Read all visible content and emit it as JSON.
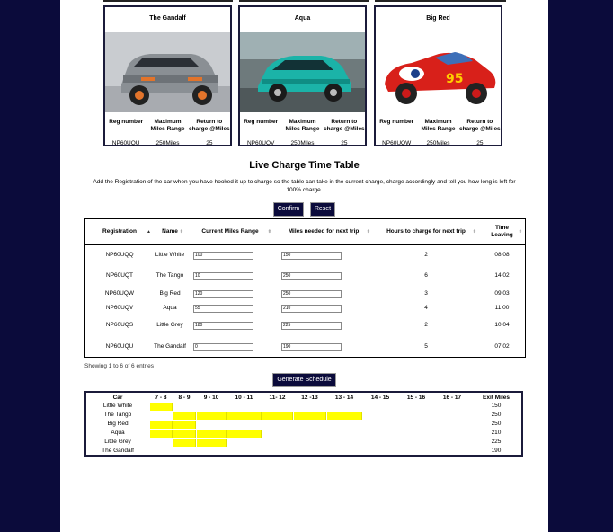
{
  "cars": [
    {
      "name": "The Gandalf",
      "headers": [
        "Reg number",
        "Maximum Miles Range",
        "Return to charge @Miles"
      ],
      "reg": "NP60UQU",
      "range": "250Miles",
      "return": "25",
      "img": "grey-suv"
    },
    {
      "name": "Aqua",
      "headers": [
        "Reg number",
        "Maximum Miles Range",
        "Return to charge @Miles"
      ],
      "reg": "NP60UQV",
      "range": "250Miles",
      "return": "25",
      "img": "teal-hatchback"
    },
    {
      "name": "Big Red",
      "headers": [
        "Reg number",
        "Maximum Miles Range",
        "Return to charge @Miles"
      ],
      "reg": "NP60UQW",
      "range": "250Miles",
      "return": "25",
      "img": "red-toy-car"
    }
  ],
  "timetable": {
    "title": "Live Charge Time Table",
    "description": "Add the Registration of the car when you have hooked it up to charge so the table can take in the current charge, charge accordingly and tell you how long is left for 100% charge.",
    "confirm_label": "Confirm",
    "reset_label": "Reset",
    "columns": [
      "Registration",
      "Name",
      "Current Miles Range",
      "Miles needed for next trip",
      "Hours to charge for next trip",
      "Time Leaving"
    ],
    "rows": [
      {
        "reg": "NP60UQQ",
        "name": "Little White",
        "current": "100",
        "needed": "150",
        "hours": "2",
        "leaving": "08:08"
      },
      {
        "reg": "NP60UQT",
        "name": "The Tango",
        "current": "10",
        "needed": "250",
        "hours": "6",
        "leaving": "14:02"
      },
      {
        "reg": "NP60UQW",
        "name": "Big Red",
        "current": "120",
        "needed": "250",
        "hours": "3",
        "leaving": "09:03"
      },
      {
        "reg": "NP60UQV",
        "name": "Aqua",
        "current": "55",
        "needed": "210",
        "hours": "4",
        "leaving": "11:00"
      },
      {
        "reg": "NP60UQS",
        "name": "Little Grey",
        "current": "180",
        "needed": "225",
        "hours": "2",
        "leaving": "10:04"
      },
      {
        "reg": "NP60UQU",
        "name": "The Gandalf",
        "current": "0",
        "needed": "190",
        "hours": "5",
        "leaving": "07:02"
      }
    ],
    "showing": "Showing 1 to 6 of 6 entries",
    "generate_label": "Generate Schedule"
  },
  "schedule": {
    "car_header": "Car",
    "slots": [
      "7 - 8",
      "8 - 9",
      "9 - 10",
      "10 - 11",
      "11- 12",
      "12 -13",
      "13 - 14",
      "14 - 15",
      "15 - 16",
      "16 - 17"
    ],
    "exit_header": "Exit Miles",
    "highlight_color": "#ffff00",
    "rows": [
      {
        "car": "Little White",
        "start": 0,
        "hours": 1,
        "exit": "150"
      },
      {
        "car": "The Tango",
        "start": 1,
        "hours": 6,
        "exit": "250"
      },
      {
        "car": "Big Red",
        "start": 0,
        "hours": 2,
        "exit": "250"
      },
      {
        "car": "Aqua",
        "start": 0,
        "hours": 4,
        "exit": "210"
      },
      {
        "car": "Little Grey",
        "start": 1,
        "hours": 2,
        "exit": "225"
      },
      {
        "car": "The Gandalf",
        "start": 0,
        "hours": 0,
        "exit": "190"
      }
    ]
  }
}
